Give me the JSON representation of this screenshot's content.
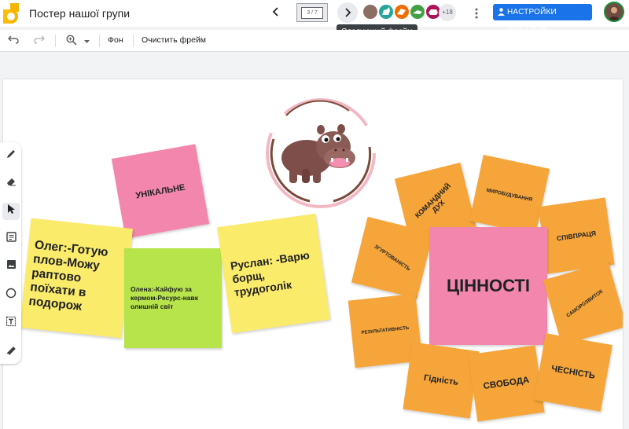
{
  "header": {
    "title": "Постер нашої групи",
    "frame_indicator": "3 / 7",
    "tooltip": "Следующий фрейм",
    "collaborators_extra": "+18",
    "access_button": "НАСТРОЙКИ ДОСТУПА"
  },
  "toolbar": {
    "background_label": "Фон",
    "clear_frame_label": "Очистить фрейм"
  },
  "notes": {
    "unique": "УНІКАЛЬНЕ",
    "oleg": "Олег:-Готую плов-Можу раптово поїхати в подорож",
    "olena": "Олена:-Кайфую за кермом-Ресурс-навк олишній світ",
    "ruslan": "Руслан: -Варю борщ, трудоголік",
    "team_spirit": "КОМАНДНИЙ ДУХ",
    "world_building": "МИРОБУДУВАННЯ",
    "cooperation": "СПІВПРАЦЯ",
    "cohesion": "ЗГУРТОВАНІСТЬ",
    "values": "ЦІННОСТІ",
    "self_development": "САМОРОЗВИТОК",
    "effectiveness": "РЕЗУЛЬТАТИВНІСТЬ",
    "dignity": "Гідність",
    "freedom": "СВОБОДА",
    "honesty": "ЧЕСНІСТЬ"
  },
  "colors": {
    "accent": "#1a73e8",
    "yellow_note": "#fbeb6b",
    "green_note": "#b6e44a",
    "pink_note": "#f286ad",
    "orange_note": "#f6a53a"
  },
  "icons": {
    "logo": "jamboard-logo",
    "prev": "chevron-left-icon",
    "next": "chevron-right-icon",
    "menu": "more-vert-icon",
    "access": "person-icon",
    "undo": "undo-icon",
    "redo": "redo-icon",
    "zoom": "zoom-icon",
    "tools": [
      "pen-icon",
      "eraser-icon",
      "select-icon",
      "sticky-note-icon",
      "image-icon",
      "circle-icon",
      "text-box-icon",
      "laser-icon"
    ]
  }
}
